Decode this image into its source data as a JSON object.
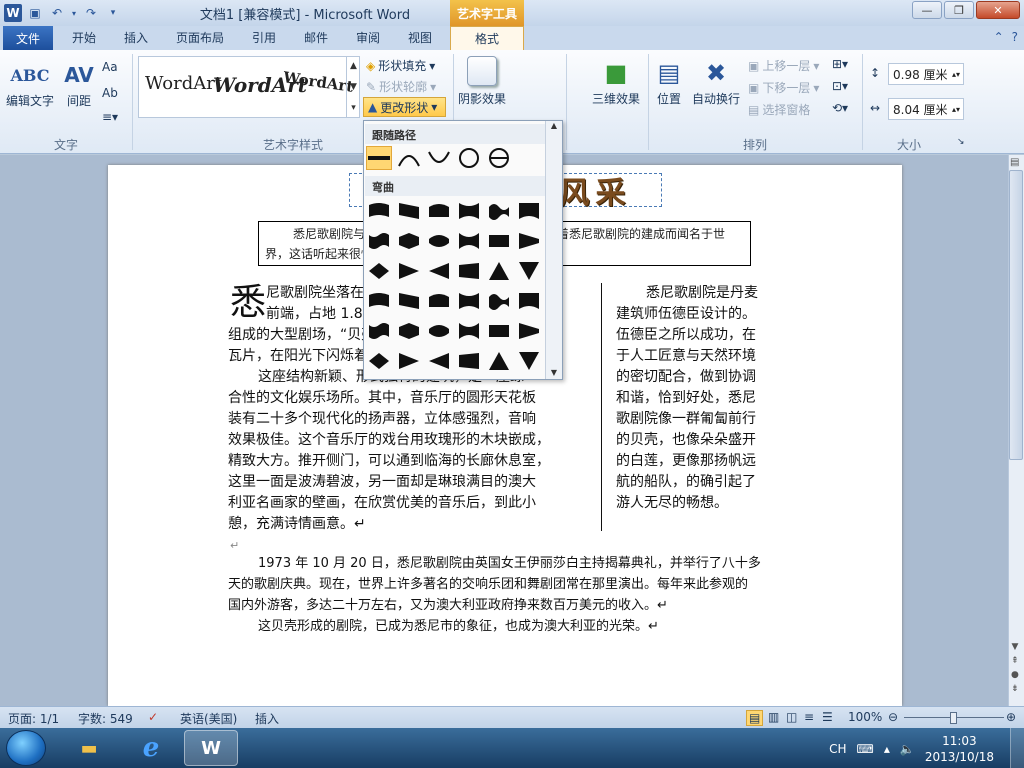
{
  "window": {
    "title": "文档1 [兼容模式] - Microsoft Word",
    "contextual_tab_group": "艺术字工具"
  },
  "tabs": [
    "文件",
    "开始",
    "插入",
    "页面布局",
    "引用",
    "邮件",
    "审阅",
    "视图",
    "格式"
  ],
  "ribbon": {
    "text_group": {
      "label": "文字",
      "edit_text": "编辑文字",
      "spacing": "间距"
    },
    "wordart_styles_group": {
      "label": "艺术字样式",
      "gallery": [
        "WordArt",
        "WordArt",
        "WordArt"
      ],
      "shape_fill": "形状填充",
      "shape_outline": "形状轮廓",
      "change_shape": "更改形状"
    },
    "shadow_effects": "阴影效果",
    "threed_effects": "三维效果",
    "arrange_group": {
      "label": "排列",
      "position": "位置",
      "wrap_text": "自动换行",
      "bring_forward": "上移一层",
      "send_backward": "下移一层",
      "selection_pane": "选择窗格"
    },
    "size_group": {
      "label": "大小",
      "height": "0.98 厘米",
      "width": "8.04 厘米"
    }
  },
  "shape_menu": {
    "section_follow_path": "跟随路径",
    "section_warp": "弯曲"
  },
  "document": {
    "heading": "悉尼歌剧院风采",
    "intro": "悉尼歌剧院与悉尼的关系：澳大利亚的悉尼城是随着悉尼歌剧院的建成而闻名于世界，这话听起来很惊人，都觉得此话并非夸张。↵",
    "drop_cap": "悉",
    "left_col": [
      "尼歌剧院坐落在悉尼港湾的便利朗角半岛",
      "前端，占地 1.84 公顷，是由三组贝壳形屋顶",
      "组成的大型剧场，“贝壳”上覆盖着白色的陶瓷",
      "瓦片，在阳光下闪烁着耀眼的光芒。",
      "这座结构新颖、形式独特的建筑，是一座综",
      "合性的文化娱乐场所。其中，音乐厅的圆形天花板",
      "装有二十多个现代化的扬声器，立体感强烈，音响",
      "效果极佳。这个音乐厅的戏台用玫瑰形的木块嵌成，",
      "精致大方。推开侧门，可以通到临海的长廊休息室，",
      "这里一面是波涛碧波，另一面却是琳琅满目的澳大",
      "利亚名画家的壁画，在欣赏优美的音乐后，到此小",
      "憩，充满诗情画意。↵"
    ],
    "right_col": [
      "悉尼歌剧院是丹麦",
      "建筑师伍德臣设计的。",
      "伍德臣之所以成功，在",
      "于人工匠意与天然环境",
      "的密切配合，做到协调",
      "和谐，恰到好处，悉尼",
      "歌剧院像一群匍匐前行",
      "的贝壳，也像朵朵盛开",
      "的白莲，更像那扬帆远",
      "航的船队，的确引起了",
      "游人无尽的畅想。"
    ],
    "para_mark": "↵",
    "para2": [
      "1973 年 10 月 20 日，悉尼歌剧院由英国女王伊丽莎白主持揭幕典礼，并举行了八十多",
      "天的歌剧庆典。现在，世界上许多著名的交响乐团和舞剧团常在那里演出。每年来此参观的",
      "国内外游客，多达二十万左右，又为澳大利亚政府挣来数百万美元的收入。↵"
    ],
    "para3": "这贝壳形成的剧院，已成为悉尼市的象征，也成为澳大利亚的光荣。↵"
  },
  "status": {
    "page": "页面: 1/1",
    "words": "字数: 549",
    "language": "英语(美国)",
    "mode": "插入",
    "zoom": "100%"
  },
  "taskbar": {
    "ime": "CH",
    "time": "11:03",
    "date": "2013/10/18"
  }
}
